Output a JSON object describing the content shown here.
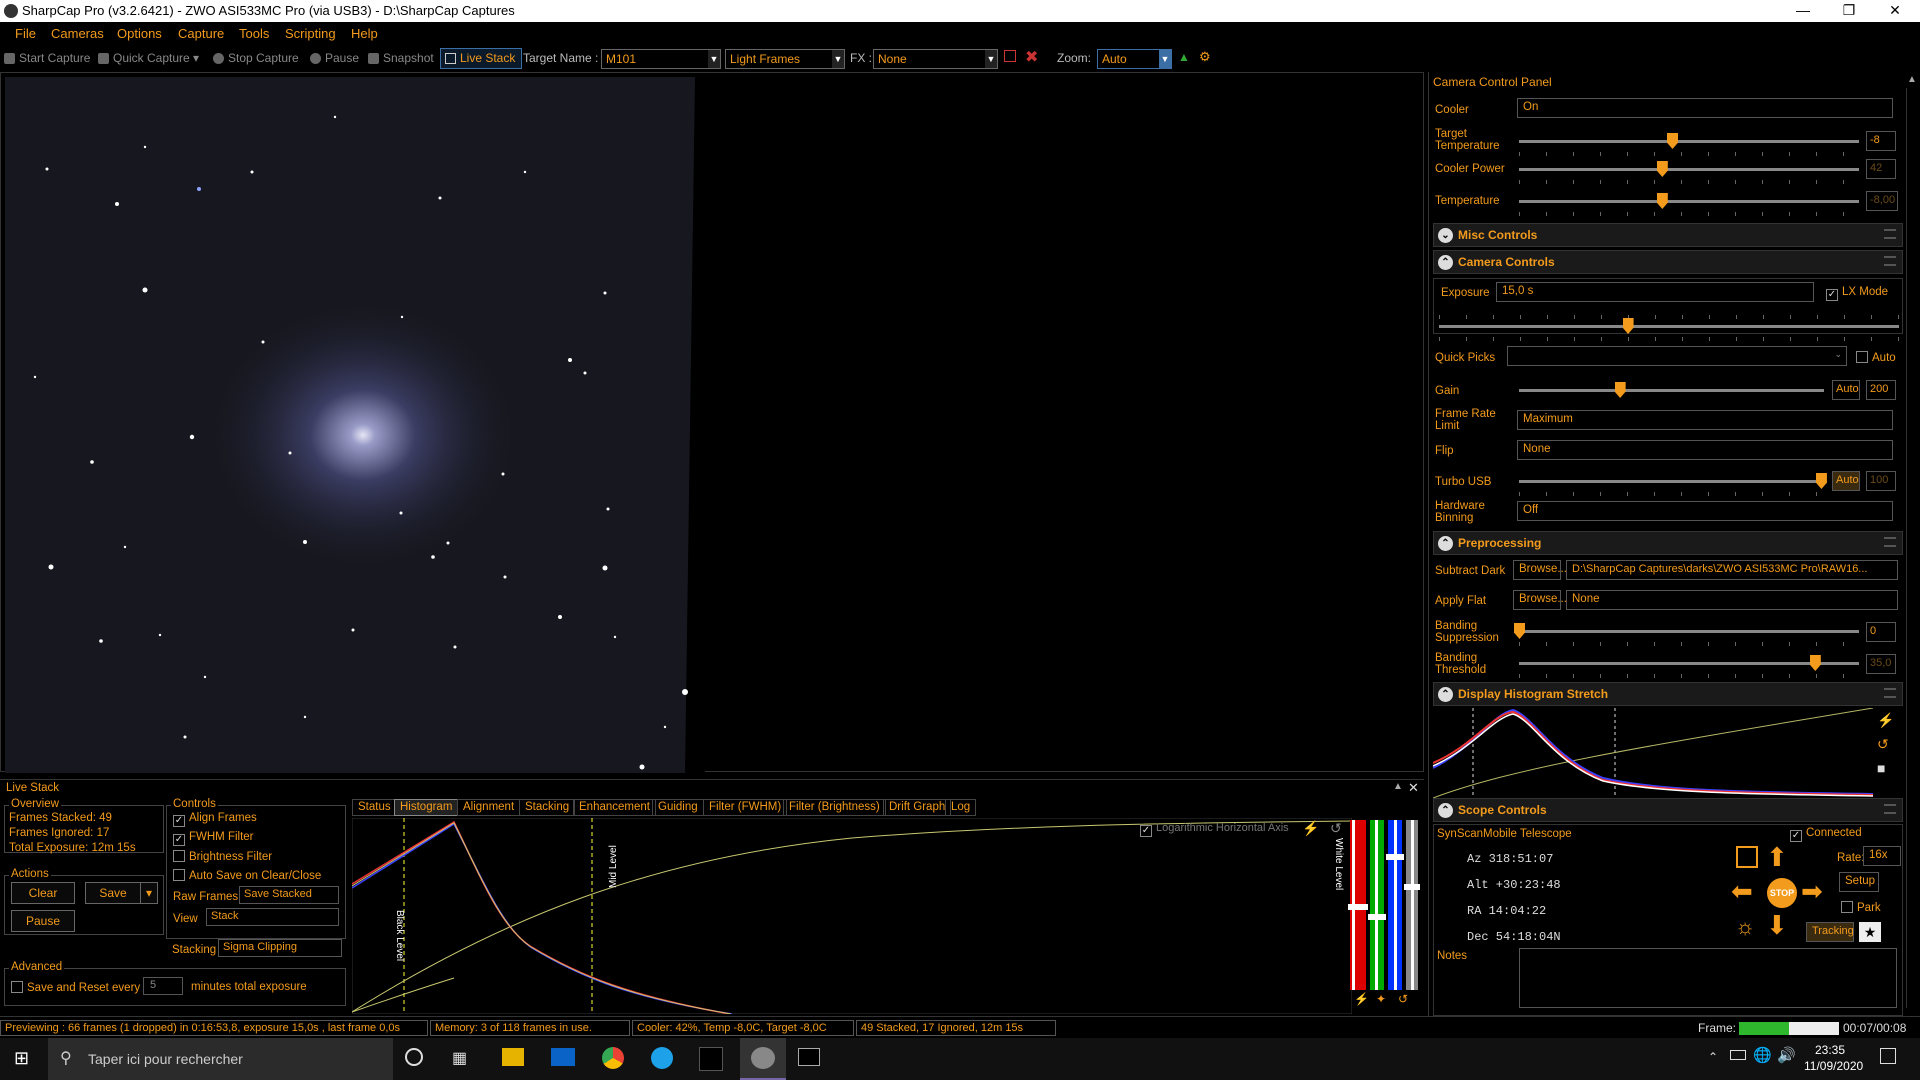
{
  "window": {
    "title": "SharpCap Pro (v3.2.6421) - ZWO ASI533MC Pro (via USB3) - D:\\SharpCap Captures"
  },
  "menu": [
    "File",
    "Cameras",
    "Options",
    "Capture",
    "Tools",
    "Scripting",
    "Help"
  ],
  "toolbar": {
    "start_capture": "Start Capture",
    "quick_capture": "Quick Capture",
    "stop_capture": "Stop Capture",
    "pause": "Pause",
    "snapshot": "Snapshot",
    "live_stack": "Live Stack",
    "target_name_label": "Target Name :",
    "target_name": "M101",
    "frame_type": "Light Frames",
    "fx_label": "FX :",
    "fx_value": "None",
    "zoom_label": "Zoom:",
    "zoom_value": "Auto"
  },
  "ccp": {
    "title": "Camera Control Panel",
    "cooler_label": "Cooler",
    "cooler_value": "On",
    "target_temp_label": "Target Temperature",
    "target_temp_value": "-8",
    "target_temp_pos": 0.45,
    "cooler_power_label": "Cooler Power",
    "cooler_power_value": "42",
    "cooler_power_pos": 0.42,
    "temperature_label": "Temperature",
    "temperature_value": "-8,00",
    "temperature_pos": 0.42,
    "misc_controls": "Misc Controls",
    "camera_controls": "Camera Controls",
    "exposure_label": "Exposure",
    "exposure_value": "15,0 s",
    "lx_mode": "LX Mode",
    "exposure_pos": 0.41,
    "quick_picks_label": "Quick Picks",
    "auto_label": "Auto",
    "gain_label": "Gain",
    "gain_auto": "Auto",
    "gain_value": "200",
    "gain_pos": 0.33,
    "frame_rate_label": "Frame Rate Limit",
    "frame_rate_value": "Maximum",
    "flip_label": "Flip",
    "flip_value": "None",
    "turbo_label": "Turbo USB",
    "turbo_auto": "Auto",
    "turbo_value": "100",
    "turbo_pos": 0.99,
    "hw_binning_label": "Hardware Binning",
    "hw_binning_value": "Off",
    "preprocessing": "Preprocessing",
    "subtract_dark_label": "Subtract Dark",
    "browse": "Browse...",
    "subtract_dark_value": "D:\\SharpCap Captures\\darks\\ZWO ASI533MC Pro\\RAW16...",
    "apply_flat_label": "Apply Flat",
    "apply_flat_value": "None",
    "banding_supp_label": "Banding Suppression",
    "banding_supp_value": "0",
    "banding_supp_pos": 0.0,
    "banding_thr_label": "Banding Threshold",
    "banding_thr_value": "35,0",
    "banding_thr_pos": 0.87,
    "histogram_stretch": "Display Histogram Stretch",
    "scope_controls": "Scope Controls",
    "scope_name": "SynScanMobile Telescope",
    "connected": "Connected",
    "az": "Az  318:51:07",
    "alt": "Alt +30:23:48",
    "ra": "RA  14:04:22",
    "dec": "Dec  54:18:04N",
    "rate_label": "Rate:",
    "rate_value": "16x",
    "setup": "Setup",
    "park": "Park",
    "tracking": "Tracking",
    "stop": "STOP",
    "notes_label": "Notes"
  },
  "livestack": {
    "title": "Live Stack",
    "overview": "Overview",
    "frames_stacked": "Frames Stacked: 49",
    "frames_ignored": "Frames Ignored:   17",
    "total_exposure": "Total Exposure:   12m 15s",
    "actions": "Actions",
    "clear": "Clear",
    "save": "Save",
    "pause": "Pause",
    "controls": "Controls",
    "align_frames": "Align Frames",
    "fwhm_filter": "FWHM Filter",
    "brightness_filter": "Brightness Filter",
    "auto_save": "Auto Save on Clear/Close",
    "raw_frames_label": "Raw Frames",
    "raw_frames_value": "Save Stacked",
    "view_label": "View",
    "view_value": "Stack",
    "stacking_label": "Stacking",
    "stacking_value": "Sigma Clipping",
    "advanced": "Advanced",
    "save_reset": "Save and Reset every",
    "save_reset_value": "5",
    "save_reset_suffix": "minutes total exposure",
    "tabs": [
      "Status",
      "Histogram",
      "Alignment",
      "Stacking",
      "Enhancement",
      "Guiding",
      "Filter (FWHM)",
      "Filter (Brightness)",
      "Drift Graph",
      "Log"
    ],
    "log_axis": "Logarithmic Horizontal Axis",
    "black_level": "Black Level",
    "mid_level": "Mid Level",
    "white_level": "White Level"
  },
  "status": {
    "preview": "Previewing : 66 frames (1 dropped) in 0:16:53,8, exposure 15,0s , last frame 0,0s",
    "memory": "Memory: 3 of 118 frames in use.",
    "cooler": "Cooler: 42%, Temp -8,0C, Target -8,0C",
    "stack": "49 Stacked, 17 Ignored, 12m 15s",
    "frame_label": "Frame:",
    "frame_time": "00:07/00:08",
    "frame_progress": 0.5
  },
  "taskbar": {
    "search": "Taper ici pour rechercher",
    "time": "23:35",
    "date": "11/09/2020"
  },
  "colors": {
    "accent": "#f39b1c"
  }
}
